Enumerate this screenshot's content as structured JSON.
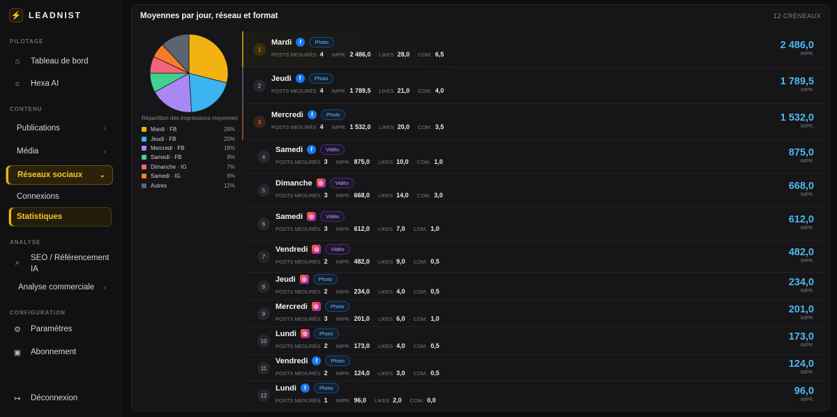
{
  "brand": {
    "name": "LEADNIST"
  },
  "sidebar": {
    "sections": {
      "pilotage": "PILOTAGE",
      "contenu": "CONTENU",
      "analyse": "ANALYSE",
      "configuration": "CONFIGURATION"
    },
    "items": {
      "dashboard": "Tableau de bord",
      "hexa": "Hexa AI",
      "publications": "Publications",
      "media": "Média",
      "social": "Réseaux sociaux",
      "connexions": "Connexions",
      "statistiques": "Statistiques",
      "seo_line1": "SEO / Référencement",
      "seo_line2": "IA",
      "commercial": "Analyse commerciale",
      "parametres": "Paramètres",
      "abonnement": "Abonnement",
      "logout": "Déconnexion"
    }
  },
  "panel": {
    "title": "Moyennes par jour, réseau et format",
    "count": "12 CRÉNEAUX",
    "legend_title": "Répartition des impressions moyennes",
    "metric_labels": {
      "posts": "POSTS MESURÉS",
      "impr": "IMPR.",
      "likes": "LIKES",
      "com": "COM.",
      "unit": "IMPR."
    }
  },
  "chart_data": {
    "type": "pie",
    "title": "",
    "categories": [
      "Mardi · FB",
      "Jeudi · FB",
      "Mercredi · FB",
      "Samedi · FB",
      "Dimanche · IG",
      "Samedi · IG",
      "Autres"
    ],
    "values": [
      29,
      20,
      18,
      8,
      7,
      6,
      12
    ],
    "labels": [
      "29%",
      "20%",
      "18%",
      "8%",
      "7%",
      "6%",
      "12%"
    ],
    "colors": [
      "#f2b312",
      "#3cb4ef",
      "#a889f4",
      "#3fd28f",
      "#f26478",
      "#f57c2b",
      "#5c6470"
    ]
  },
  "rows": [
    {
      "rank": "1",
      "day": "Mardi",
      "network": "fb",
      "format": "Photo",
      "posts": "4",
      "impr": "2 486,0",
      "likes": "28,0",
      "com": "6,5",
      "value": "2 486,0"
    },
    {
      "rank": "2",
      "day": "Jeudi",
      "network": "fb",
      "format": "Photo",
      "posts": "4",
      "impr": "1 789,5",
      "likes": "21,0",
      "com": "4,0",
      "value": "1 789,5"
    },
    {
      "rank": "3",
      "day": "Mercredi",
      "network": "fb",
      "format": "Photo",
      "posts": "4",
      "impr": "1 532,0",
      "likes": "20,0",
      "com": "3,5",
      "value": "1 532,0"
    },
    {
      "rank": "4",
      "day": "Samedi",
      "network": "fb",
      "format": "Vidéo",
      "posts": "3",
      "impr": "875,0",
      "likes": "10,0",
      "com": "1,0",
      "value": "875,0"
    },
    {
      "rank": "5",
      "day": "Dimanche",
      "network": "ig",
      "format": "Vidéo",
      "posts": "3",
      "impr": "668,0",
      "likes": "14,0",
      "com": "3,0",
      "value": "668,0"
    },
    {
      "rank": "6",
      "day": "Samedi",
      "network": "ig",
      "format": "Vidéo",
      "posts": "3",
      "impr": "612,0",
      "likes": "7,0",
      "com": "1,0",
      "value": "612,0"
    },
    {
      "rank": "7",
      "day": "Vendredi",
      "network": "ig",
      "format": "Vidéo",
      "posts": "2",
      "impr": "482,0",
      "likes": "9,0",
      "com": "0,5",
      "value": "482,0"
    },
    {
      "rank": "8",
      "day": "Jeudi",
      "network": "ig",
      "format": "Photo",
      "posts": "2",
      "impr": "234,0",
      "likes": "4,0",
      "com": "0,5",
      "value": "234,0"
    },
    {
      "rank": "9",
      "day": "Mercredi",
      "network": "ig",
      "format": "Photo",
      "posts": "3",
      "impr": "201,0",
      "likes": "6,0",
      "com": "1,0",
      "value": "201,0"
    },
    {
      "rank": "10",
      "day": "Lundi",
      "network": "ig",
      "format": "Photo",
      "posts": "2",
      "impr": "173,0",
      "likes": "4,0",
      "com": "0,5",
      "value": "173,0"
    },
    {
      "rank": "11",
      "day": "Vendredi",
      "network": "fb",
      "format": "Photo",
      "posts": "2",
      "impr": "124,0",
      "likes": "3,0",
      "com": "0,5",
      "value": "124,0"
    },
    {
      "rank": "12",
      "day": "Lundi",
      "network": "fb",
      "format": "Photo",
      "posts": "1",
      "impr": "96,0",
      "likes": "2,0",
      "com": "0,0",
      "value": "96,0"
    }
  ]
}
